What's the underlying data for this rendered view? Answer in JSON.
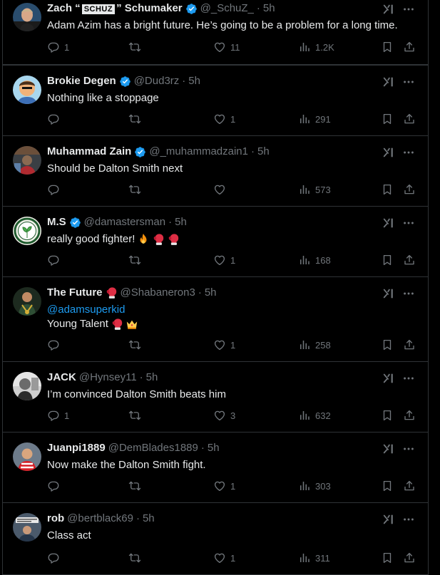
{
  "replies": [
    {
      "name": "Zach “",
      "name_badge": "SCHUZ",
      "name_suffix": "” Schumaker",
      "verified": true,
      "handle": "@_SchuZ_",
      "time": "5h",
      "text": "Adam Azim has a bright future. He’s going to be a problem for a long time.",
      "reply_count": "1",
      "like_count": "11",
      "view_count": "1.2K"
    },
    {
      "name": "Brokie Degen",
      "verified": true,
      "handle": "@Dud3rz",
      "time": "5h",
      "text": "Nothing like a stoppage",
      "reply_count": "",
      "like_count": "1",
      "view_count": "291"
    },
    {
      "name": "Muhammad Zain",
      "verified": true,
      "handle": "@_muhammadzain1",
      "time": "5h",
      "text": "Should be Dalton Smith next",
      "reply_count": "",
      "like_count": "",
      "view_count": "573"
    },
    {
      "name": "M.S",
      "verified": true,
      "handle": "@damastersman",
      "time": "5h",
      "text": "really good fighter!",
      "emojis": [
        "fire-emoji",
        "boxing-glove-emoji",
        "boxing-glove-emoji"
      ],
      "reply_count": "",
      "like_count": "1",
      "view_count": "168"
    },
    {
      "name": "The Future",
      "name_emoji": "boxing-glove-emoji",
      "verified": false,
      "handle": "@Shabaneron3",
      "time": "5h",
      "mention": "@adamsuperkid",
      "text": "Young Talent",
      "emojis": [
        "boxing-glove-emoji",
        "crown-emoji"
      ],
      "reply_count": "",
      "like_count": "1",
      "view_count": "258"
    },
    {
      "name": "JACK",
      "verified": false,
      "handle": "@Hynsey11",
      "time": "5h",
      "text": "I’m convinced Dalton Smith beats him",
      "reply_count": "1",
      "like_count": "3",
      "view_count": "632"
    },
    {
      "name": "Juanpi1889",
      "verified": false,
      "handle": "@DemBlades1889",
      "time": "5h",
      "text": "Now make the Dalton Smith fight.",
      "reply_count": "",
      "like_count": "1",
      "view_count": "303"
    },
    {
      "name": "rob",
      "verified": false,
      "handle": "@bertblack69",
      "time": "5h",
      "text": "Class act",
      "reply_count": "",
      "like_count": "1",
      "view_count": "311"
    }
  ],
  "separator": "·",
  "colors": {
    "background": "#000000",
    "text": "#e7e9ea",
    "secondary": "#71767b",
    "link": "#1d9bf0",
    "verified": "#1d9bf0",
    "border": "#2f3336"
  }
}
